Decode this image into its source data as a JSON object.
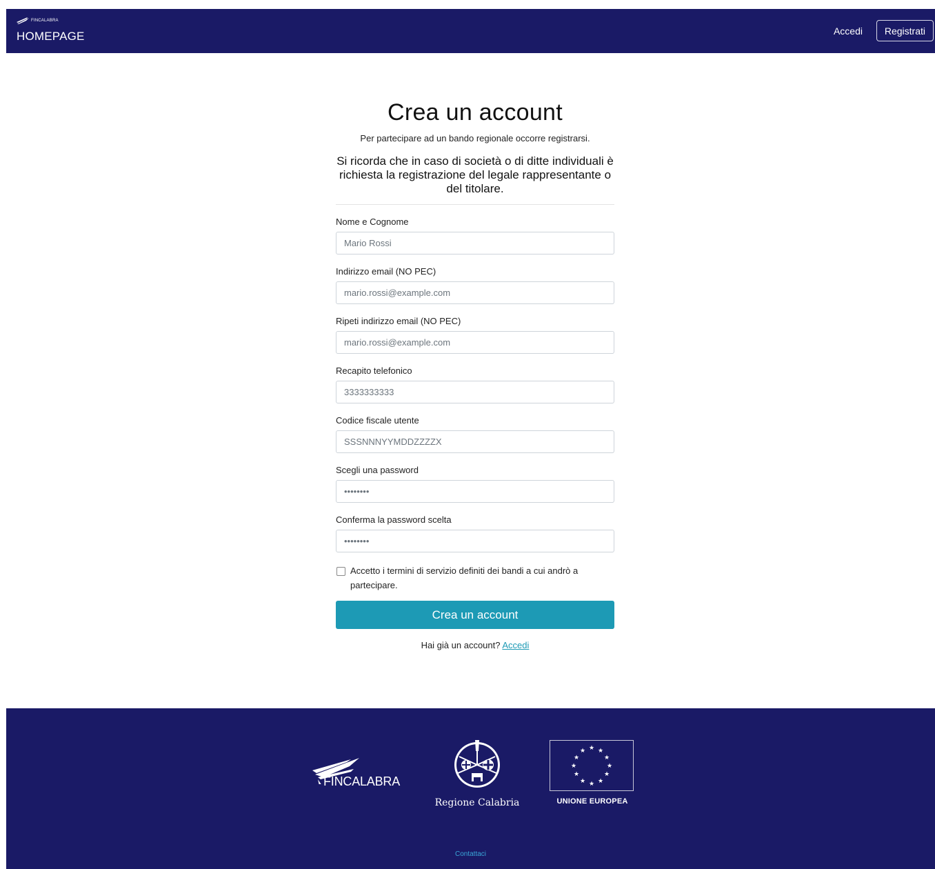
{
  "header": {
    "brand_small": "FINCALABRA",
    "brand": "HOMEPAGE",
    "login": "Accedi",
    "register": "Registrati"
  },
  "form": {
    "title": "Crea un account",
    "subtitle": "Per partecipare ad un bando regionale occorre registrarsi.",
    "notice": "Si ricorda che in caso di società o di ditte individuali è richiesta la registrazione del legale rappresentante o del titolare.",
    "fields": [
      {
        "label": "Nome e Cognome",
        "placeholder": "Mario Rossi"
      },
      {
        "label": "Indirizzo email (NO PEC)",
        "placeholder": "mario.rossi@example.com"
      },
      {
        "label": "Ripeti indirizzo email (NO PEC)",
        "placeholder": "mario.rossi@example.com"
      },
      {
        "label": "Recapito telefonico",
        "placeholder": "3333333333"
      },
      {
        "label": "Codice fiscale utente",
        "placeholder": "SSSNNNYYMDDZZZZX"
      },
      {
        "label": "Scegli una password",
        "placeholder": "••••••••"
      },
      {
        "label": "Conferma la password scelta",
        "placeholder": "••••••••"
      }
    ],
    "terms": "Accetto i termini di servizio definiti dei bandi a cui andrò a partecipare.",
    "submit": "Crea un account",
    "already_text": "Hai già un account?",
    "already_link": "Accedi"
  },
  "footer": {
    "fincalabra": "FINCALABRA",
    "regione": "Regione Calabria",
    "eu": "UNIONE EUROPEA",
    "contact": "Contattaci"
  },
  "colors": {
    "navy": "#1a1a66",
    "accent": "#1d9ab5"
  }
}
